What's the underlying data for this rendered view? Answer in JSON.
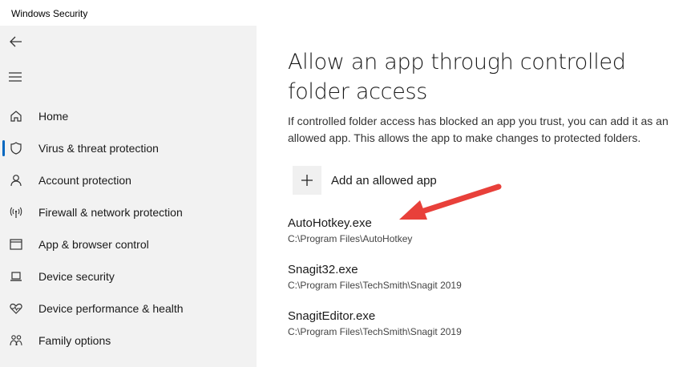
{
  "window": {
    "title": "Windows Security"
  },
  "sidebar": {
    "items": [
      {
        "label": "Home",
        "icon": "home-icon",
        "selected": false
      },
      {
        "label": "Virus & threat protection",
        "icon": "shield-icon",
        "selected": true
      },
      {
        "label": "Account protection",
        "icon": "person-icon",
        "selected": false
      },
      {
        "label": "Firewall & network protection",
        "icon": "wifi-antenna-icon",
        "selected": false
      },
      {
        "label": "App & browser control",
        "icon": "app-window-icon",
        "selected": false
      },
      {
        "label": "Device security",
        "icon": "laptop-icon",
        "selected": false
      },
      {
        "label": "Device performance & health",
        "icon": "heart-pulse-icon",
        "selected": false
      },
      {
        "label": "Family options",
        "icon": "family-icon",
        "selected": false
      }
    ]
  },
  "main": {
    "title": "Allow an app through controlled folder access",
    "description": "If controlled folder access has blocked an app you trust, you can add it as an allowed app. This allows the app to make changes to protected folders.",
    "add_label": "Add an allowed app",
    "apps": [
      {
        "name": "AutoHotkey.exe",
        "path": "C:\\Program Files\\AutoHotkey"
      },
      {
        "name": "Snagit32.exe",
        "path": "C:\\Program Files\\TechSmith\\Snagit 2019"
      },
      {
        "name": "SnagitEditor.exe",
        "path": "C:\\Program Files\\TechSmith\\Snagit 2019"
      }
    ]
  },
  "colors": {
    "accent": "#0067c0",
    "annotation_arrow": "#e8403a",
    "sidebar_bg": "#f2f2f2"
  }
}
